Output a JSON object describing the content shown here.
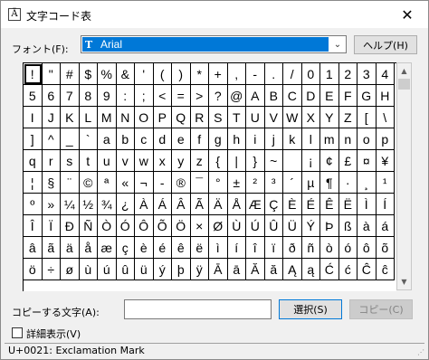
{
  "window": {
    "title": "文字コード表",
    "app_icon_glyph": "Ä",
    "close_glyph": "✕"
  },
  "font_row": {
    "label": "フォント(F):",
    "selected_font": "Arial",
    "font_type_glyph": "T",
    "dropdown_glyph": "⌄",
    "help_button": "ヘルプ(H)"
  },
  "grid": {
    "rows": [
      [
        "!",
        "\"",
        "#",
        "$",
        "%",
        "&",
        "'",
        "(",
        ")",
        "*",
        "+",
        ",",
        "-",
        ".",
        "/",
        "0",
        "1",
        "2",
        "3",
        "4"
      ],
      [
        "5",
        "6",
        "7",
        "8",
        "9",
        ":",
        ";",
        "<",
        "=",
        ">",
        "?",
        "@",
        "A",
        "B",
        "C",
        "D",
        "E",
        "F",
        "G",
        "H"
      ],
      [
        "I",
        "J",
        "K",
        "L",
        "M",
        "N",
        "O",
        "P",
        "Q",
        "R",
        "S",
        "T",
        "U",
        "V",
        "W",
        "X",
        "Y",
        "Z",
        "[",
        "\\"
      ],
      [
        "]",
        "^",
        "_",
        "`",
        "a",
        "b",
        "c",
        "d",
        "e",
        "f",
        "g",
        "h",
        "i",
        "j",
        "k",
        "l",
        "m",
        "n",
        "o",
        "p"
      ],
      [
        "q",
        "r",
        "s",
        "t",
        "u",
        "v",
        "w",
        "x",
        "y",
        "z",
        "{",
        "|",
        "}",
        "~",
        " ",
        "¡",
        "¢",
        "£",
        "¤",
        "¥"
      ],
      [
        "¦",
        "§",
        "¨",
        "©",
        "ª",
        "«",
        "¬",
        "-",
        "®",
        "¯",
        "°",
        "±",
        "²",
        "³",
        "´",
        "µ",
        "¶",
        "·",
        "¸",
        "¹"
      ],
      [
        "º",
        "»",
        "¼",
        "½",
        "¾",
        "¿",
        "À",
        "Á",
        "Â",
        "Ã",
        "Ä",
        "Å",
        "Æ",
        "Ç",
        "È",
        "É",
        "Ê",
        "Ë",
        "Ì",
        "Í"
      ],
      [
        "Î",
        "Ï",
        "Ð",
        "Ñ",
        "Ò",
        "Ó",
        "Ô",
        "Õ",
        "Ö",
        "×",
        "Ø",
        "Ù",
        "Ú",
        "Û",
        "Ü",
        "Ý",
        "Þ",
        "ß",
        "à",
        "á"
      ],
      [
        "â",
        "ã",
        "ä",
        "å",
        "æ",
        "ç",
        "è",
        "é",
        "ê",
        "ë",
        "ì",
        "í",
        "î",
        "ï",
        "ð",
        "ñ",
        "ò",
        "ó",
        "ô",
        "õ"
      ],
      [
        "ö",
        "÷",
        "ø",
        "ù",
        "ú",
        "û",
        "ü",
        "ý",
        "þ",
        "ÿ",
        "Ā",
        "ā",
        "Ă",
        "ă",
        "Ą",
        "ą",
        "Ć",
        "ć",
        "Ĉ",
        "ĉ"
      ]
    ],
    "selected_char": "!"
  },
  "scrollbar": {
    "up_glyph": "▲",
    "down_glyph": "▼"
  },
  "copy_row": {
    "label": "コピーする文字(A):",
    "value": "",
    "select_button": "選択(S)",
    "copy_button": "コピー(C)"
  },
  "advanced": {
    "label": "詳細表示(V)",
    "checked": false
  },
  "status": {
    "text": "U+0021: Exclamation Mark"
  }
}
